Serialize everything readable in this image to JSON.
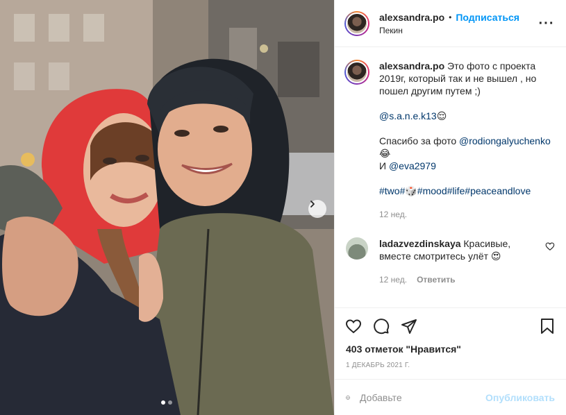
{
  "author": {
    "username": "alexsandra.po",
    "follow_label": "Подписаться",
    "location": "Пекин",
    "avatar_icon": "profile-photo-avatar"
  },
  "caption": {
    "username": "alexsandra.po",
    "line1": "Это фото с проекта 2019г, который так и не вышел , но пошел другим путем ;)",
    "mention1": "@s.a.n.e.k13",
    "mention1_emoji": "😌",
    "thanks_prefix": "Спасибо за фото ",
    "mention2": "@rodiongalyuchenko",
    "mention2_emoji": "😂",
    "and_prefix": "И ",
    "mention3": "@eva2979",
    "hashtag1": "#two#",
    "hashtag_emoji": "🎲",
    "hashtag2": "#mood#life#peaceandlove",
    "time": "12 нед."
  },
  "comments": [
    {
      "username": "ladazvezdinskaya",
      "text": "Красивые, вместе смотритесь улёт",
      "emoji": "😍",
      "time": "12 нед.",
      "reply_label": "Ответить"
    }
  ],
  "actions": {
    "like_icon": "heart-icon",
    "comment_icon": "comment-bubble-icon",
    "share_icon": "paper-plane-icon",
    "save_icon": "bookmark-icon"
  },
  "likes_text": "403 отметок \"Нравится\"",
  "date": "1 ДЕКАБРЬ 2021 Г.",
  "add_comment": {
    "placeholder": "Добавьте",
    "publish_label": "Опубликовать"
  },
  "carousel": {
    "slide_count": 2,
    "active_slide": 1
  },
  "colors": {
    "accent": "#0095f6",
    "link": "#00376b",
    "muted": "#8e8e8e",
    "publish_disabled": "#b2dffc"
  }
}
